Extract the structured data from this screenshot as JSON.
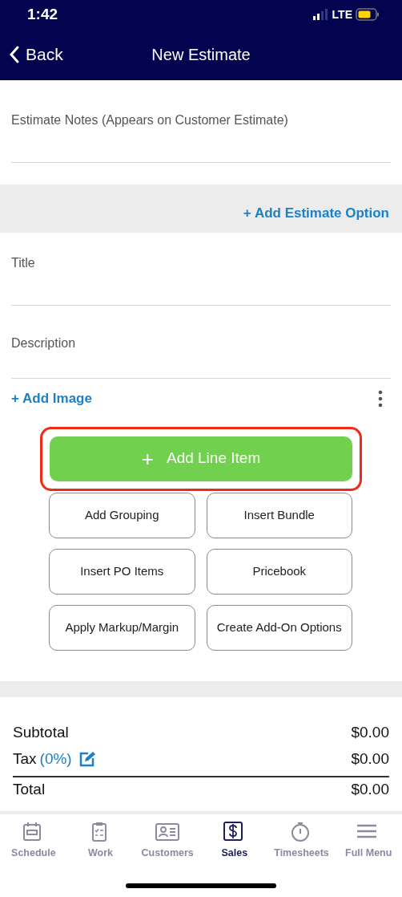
{
  "status_bar": {
    "time": "1:42",
    "network": "LTE"
  },
  "nav": {
    "back": "Back",
    "title": "New Estimate"
  },
  "notes": {
    "placeholder": "Estimate Notes (Appears on Customer Estimate)"
  },
  "add_option": "+ Add Estimate Option",
  "fields": [
    {
      "placeholder": "Title"
    },
    {
      "placeholder": "Description"
    }
  ],
  "add_image": "+ Add Image",
  "add_line_item": {
    "icon": "+",
    "label": "Add Line Item",
    "highlighted": true
  },
  "actions": [
    "Add Grouping",
    "Insert Bundle",
    "Insert PO Items",
    "Pricebook",
    "Apply Markup/Margin",
    "Create Add-On Options"
  ],
  "totals": [
    {
      "kind": "plain",
      "label": "Subtotal",
      "value": "$0.00"
    },
    {
      "kind": "tax",
      "label": "Tax",
      "rate": "(0%)",
      "value": "$0.00"
    },
    {
      "kind": "total",
      "label": "Total",
      "value": "$0.00"
    }
  ],
  "tabs": [
    {
      "label": "Schedule",
      "kind": "calendar",
      "selected": false
    },
    {
      "label": "Work",
      "kind": "clipboard",
      "selected": false
    },
    {
      "label": "Customers",
      "kind": "card",
      "selected": false
    },
    {
      "label": "Sales",
      "kind": "dollar",
      "selected": true
    },
    {
      "label": "Timesheets",
      "kind": "stopwatch",
      "selected": false
    },
    {
      "label": "Full Menu",
      "kind": "menu",
      "selected": false
    }
  ]
}
